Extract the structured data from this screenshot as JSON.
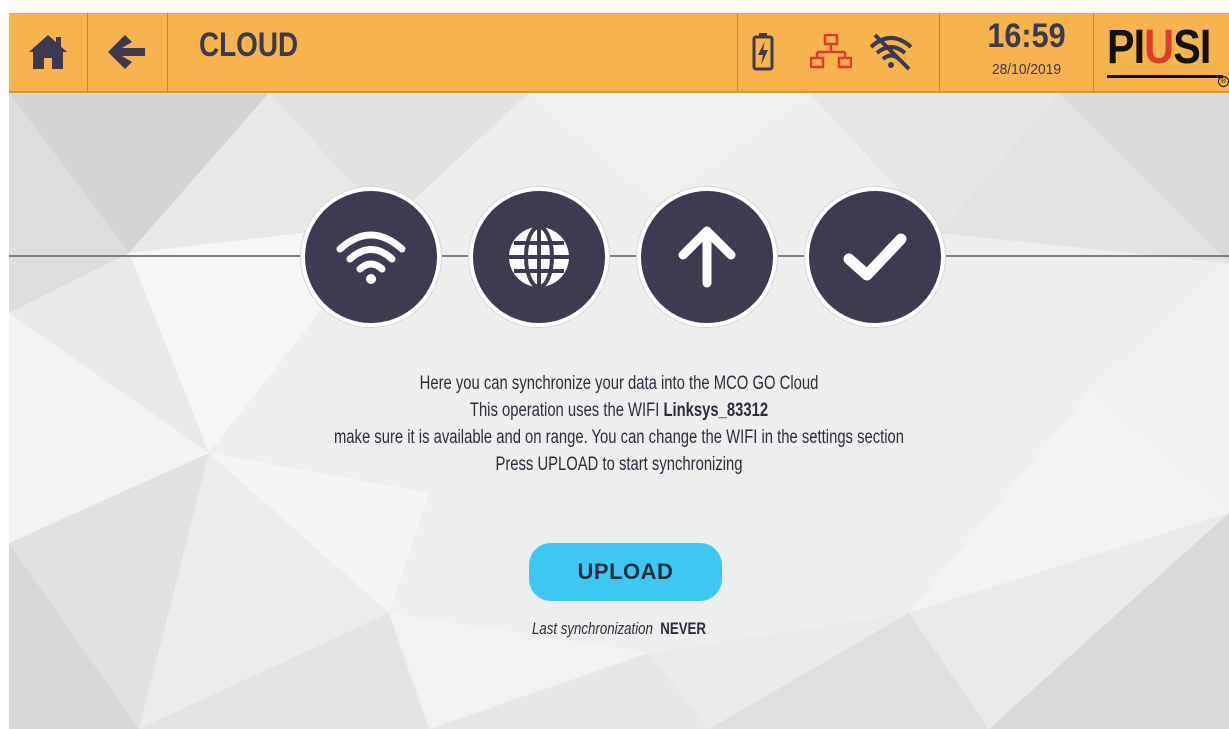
{
  "header": {
    "title": "CLOUD",
    "time": "16:59",
    "date": "28/10/2019",
    "brand": "PIUSI",
    "icons": [
      "home-icon",
      "back-arrow-icon",
      "battery-charging-icon",
      "network-icon",
      "wifi-off-icon"
    ]
  },
  "steps": [
    {
      "icon": "wifi-icon"
    },
    {
      "icon": "globe-icon"
    },
    {
      "icon": "arrow-up-icon"
    },
    {
      "icon": "checkmark-icon"
    }
  ],
  "message": {
    "line1": "Here you can synchronize your data into the MCO GO Cloud",
    "line2_prefix": "This operation uses the WIFI ",
    "line2_wifi": "Linksys_83312",
    "line3": "make sure it is available and on range. You can change the WIFI in the settings section",
    "line4": "Press UPLOAD to start synchronizing"
  },
  "upload": {
    "label": "UPLOAD"
  },
  "last_sync": {
    "label": "Last synchronization",
    "value": "NEVER"
  },
  "colors": {
    "header_bg": "#f7b34c",
    "step_bg": "#3d3a52",
    "button_bg": "#3cc8f0",
    "network_icon": "#e03a2c",
    "text": "#2d2c3c"
  }
}
